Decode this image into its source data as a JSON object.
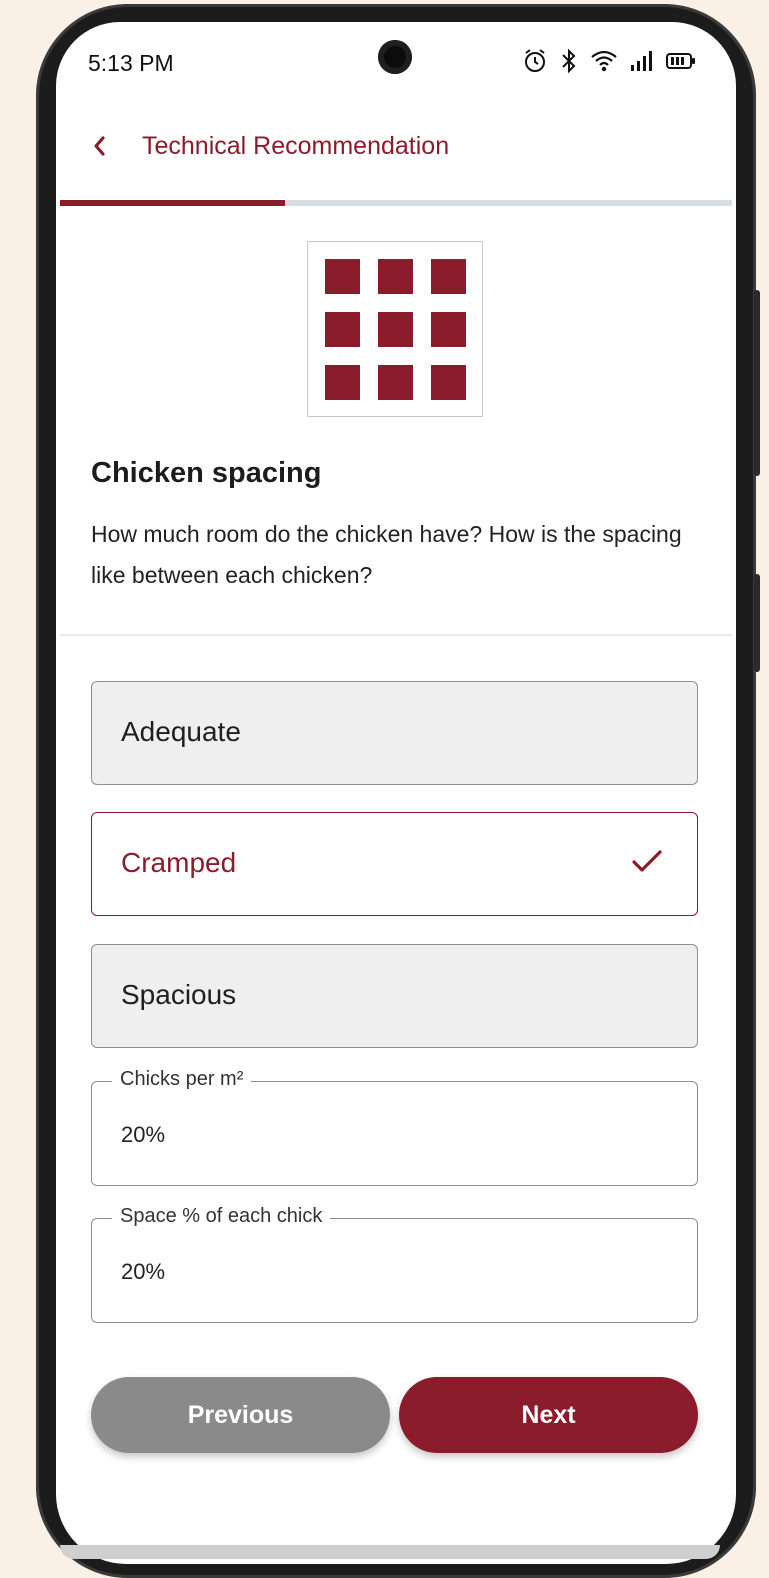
{
  "status_bar": {
    "time": "5:13 PM",
    "icons": [
      "alarm-icon",
      "bluetooth-icon",
      "wifi-icon",
      "signal-icon",
      "battery-icon"
    ]
  },
  "header": {
    "back_icon": "chevron-left-icon",
    "title": "Technical Recommendation"
  },
  "progress": {
    "fraction": 0.335
  },
  "question": {
    "image_icon": "grid-icon",
    "title": "Chicken spacing",
    "description": "How much room do the chicken have? How is the spacing like between each chicken?"
  },
  "options": [
    {
      "label": "Adequate",
      "selected": false
    },
    {
      "label": "Cramped",
      "selected": true
    },
    {
      "label": "Spacious",
      "selected": false
    }
  ],
  "fields": [
    {
      "label": "Chicks per m²",
      "value": "20%"
    },
    {
      "label": "Space % of each chick",
      "value": "20%"
    }
  ],
  "buttons": {
    "previous": "Previous",
    "next": "Next"
  },
  "colors": {
    "accent": "#8a1c2b",
    "background": "#fbf0e6",
    "option_bg": "#efefef",
    "previous_bg": "#8a8a8a"
  }
}
